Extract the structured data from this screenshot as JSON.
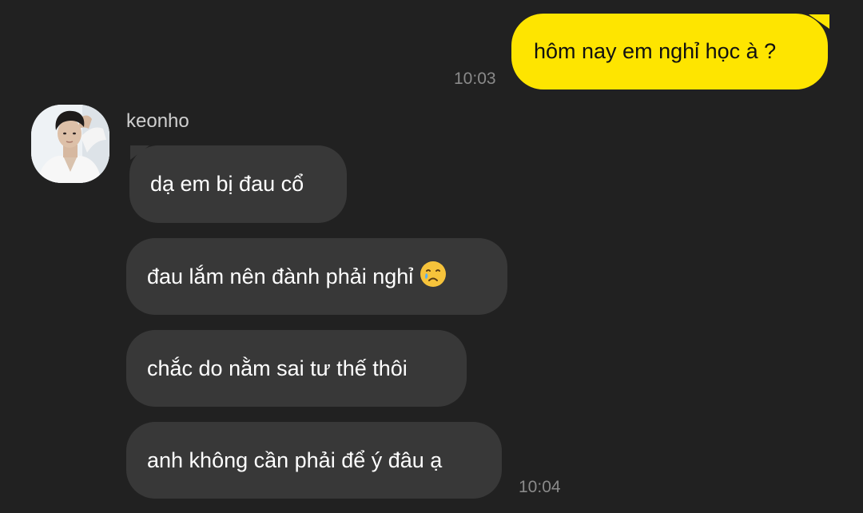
{
  "messages": {
    "outgoing": {
      "text": "hôm nay em nghỉ học à ?",
      "time": "10:03"
    },
    "incoming": {
      "sender": "keonho",
      "time": "10:04",
      "items": [
        {
          "text": "dạ em bị đau cổ"
        },
        {
          "text": "đau lắm nên đành phải nghỉ",
          "emoji": "crying-face"
        },
        {
          "text": "chắc do nằm sai tư thế thôi"
        },
        {
          "text": "anh không cần phải để ý đâu ạ"
        }
      ]
    }
  },
  "colors": {
    "background": "#212121",
    "outgoing_bubble": "#fee500",
    "incoming_bubble": "#383838",
    "timestamp": "#8a8a8a"
  }
}
